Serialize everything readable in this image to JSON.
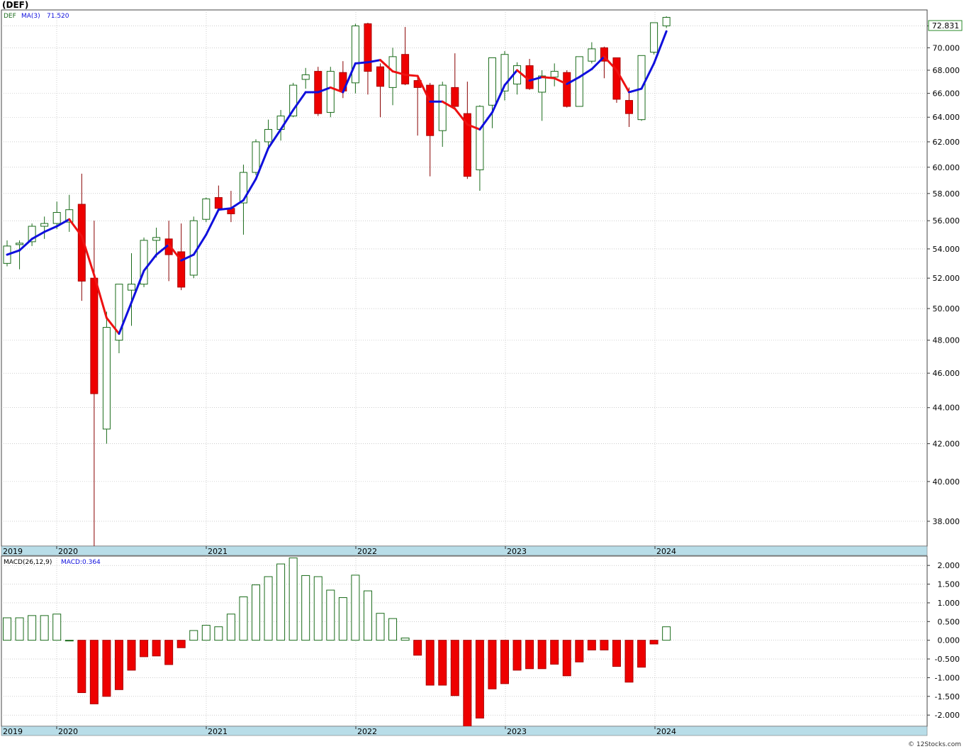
{
  "header": {
    "title": "(DEF)",
    "legend_symbol": "DEF",
    "legend_ma": "MA(3)",
    "legend_ma_value": "71.520",
    "last_price": "72.831",
    "macd_label": "MACD(26,12,9)",
    "macd_value": "MACD:0.364",
    "footer": "© 12Stocks.com"
  },
  "colors": {
    "up_candle": "#1a6b1a",
    "down_candle": "#ee0000",
    "ma_up": "#1010dd",
    "ma_down": "#ee1111",
    "grid": "#b0b0b0",
    "axis_strip": "#b8dde8",
    "price_box": "#2a8a2a"
  },
  "chart_data": [
    {
      "type": "candlestick",
      "title": "(DEF)",
      "x_axis_labels": [
        "2019",
        "2020",
        "2021",
        "2022",
        "2023",
        "2024"
      ],
      "y_ticks": [
        "38.000",
        "40.000",
        "42.000",
        "44.000",
        "46.000",
        "48.000",
        "50.000",
        "52.000",
        "54.000",
        "56.000",
        "58.000",
        "60.000",
        "62.000",
        "64.000",
        "66.000",
        "68.000",
        "70.000",
        "72.000"
      ],
      "ylim": [
        36.8,
        73.5
      ],
      "scale": "log",
      "candles": [
        {
          "date": "2019-08",
          "o": 53.0,
          "h": 54.6,
          "l": 52.8,
          "c": 54.2
        },
        {
          "date": "2019-09",
          "o": 54.3,
          "h": 54.6,
          "l": 52.6,
          "c": 54.4
        },
        {
          "date": "2019-10",
          "o": 54.5,
          "h": 55.8,
          "l": 54.2,
          "c": 55.6
        },
        {
          "date": "2019-11",
          "o": 55.6,
          "h": 56.3,
          "l": 54.7,
          "c": 55.8
        },
        {
          "date": "2019-12",
          "o": 55.8,
          "h": 57.4,
          "l": 55.4,
          "c": 56.6
        },
        {
          "date": "2020-01",
          "o": 55.9,
          "h": 57.9,
          "l": 55.2,
          "c": 56.8
        },
        {
          "date": "2020-02",
          "o": 57.2,
          "h": 59.5,
          "l": 50.5,
          "c": 51.8
        },
        {
          "date": "2020-03",
          "o": 52.0,
          "h": 56.0,
          "l": 36.8,
          "c": 44.8
        },
        {
          "date": "2020-04",
          "o": 42.8,
          "h": 49.8,
          "l": 42.0,
          "c": 48.8
        },
        {
          "date": "2020-05",
          "o": 48.0,
          "h": 51.6,
          "l": 47.2,
          "c": 51.6
        },
        {
          "date": "2020-06",
          "o": 51.2,
          "h": 53.7,
          "l": 48.9,
          "c": 51.6
        },
        {
          "date": "2020-07",
          "o": 51.6,
          "h": 54.8,
          "l": 51.4,
          "c": 54.6
        },
        {
          "date": "2020-08",
          "o": 54.6,
          "h": 55.5,
          "l": 53.4,
          "c": 54.8
        },
        {
          "date": "2020-09",
          "o": 54.7,
          "h": 56.0,
          "l": 51.8,
          "c": 53.6
        },
        {
          "date": "2020-10",
          "o": 53.8,
          "h": 55.8,
          "l": 51.2,
          "c": 51.4
        },
        {
          "date": "2020-11",
          "o": 52.2,
          "h": 56.3,
          "l": 52.0,
          "c": 56.0
        },
        {
          "date": "2020-12",
          "o": 56.1,
          "h": 57.7,
          "l": 55.9,
          "c": 57.6
        },
        {
          "date": "2021-01",
          "o": 57.7,
          "h": 58.6,
          "l": 56.7,
          "c": 56.9
        },
        {
          "date": "2021-02",
          "o": 56.9,
          "h": 58.2,
          "l": 55.9,
          "c": 56.5
        },
        {
          "date": "2021-03",
          "o": 57.3,
          "h": 60.2,
          "l": 55.0,
          "c": 59.6
        },
        {
          "date": "2021-04",
          "o": 59.6,
          "h": 62.2,
          "l": 59.4,
          "c": 62.0
        },
        {
          "date": "2021-05",
          "o": 62.0,
          "h": 63.8,
          "l": 61.6,
          "c": 63.0
        },
        {
          "date": "2021-06",
          "o": 63.0,
          "h": 64.6,
          "l": 62.1,
          "c": 64.1
        },
        {
          "date": "2021-07",
          "o": 64.1,
          "h": 66.9,
          "l": 64.0,
          "c": 66.7
        },
        {
          "date": "2021-08",
          "o": 67.2,
          "h": 68.2,
          "l": 66.4,
          "c": 67.6
        },
        {
          "date": "2021-09",
          "o": 67.9,
          "h": 68.3,
          "l": 64.1,
          "c": 64.3
        },
        {
          "date": "2021-10",
          "o": 64.4,
          "h": 68.3,
          "l": 64.0,
          "c": 67.9
        },
        {
          "date": "2021-11",
          "o": 67.8,
          "h": 68.8,
          "l": 65.6,
          "c": 66.2
        },
        {
          "date": "2021-12",
          "o": 66.9,
          "h": 72.2,
          "l": 66.0,
          "c": 72.0
        },
        {
          "date": "2022-01",
          "o": 72.2,
          "h": 72.3,
          "l": 65.9,
          "c": 67.9
        },
        {
          "date": "2022-02",
          "o": 68.3,
          "h": 68.6,
          "l": 64.0,
          "c": 66.6
        },
        {
          "date": "2022-03",
          "o": 66.5,
          "h": 70.0,
          "l": 65.0,
          "c": 69.2
        },
        {
          "date": "2022-04",
          "o": 69.4,
          "h": 71.9,
          "l": 66.7,
          "c": 66.8
        },
        {
          "date": "2022-05",
          "o": 67.1,
          "h": 67.4,
          "l": 62.5,
          "c": 66.5
        },
        {
          "date": "2022-06",
          "o": 66.7,
          "h": 66.9,
          "l": 59.3,
          "c": 62.5
        },
        {
          "date": "2022-07",
          "o": 62.9,
          "h": 67.0,
          "l": 61.6,
          "c": 66.7
        },
        {
          "date": "2022-08",
          "o": 66.5,
          "h": 69.5,
          "l": 64.8,
          "c": 64.9
        },
        {
          "date": "2022-09",
          "o": 64.3,
          "h": 67.0,
          "l": 59.1,
          "c": 59.3
        },
        {
          "date": "2022-10",
          "o": 59.8,
          "h": 65.0,
          "l": 58.2,
          "c": 64.9
        },
        {
          "date": "2022-11",
          "o": 65.0,
          "h": 69.1,
          "l": 63.1,
          "c": 69.1
        },
        {
          "date": "2022-12",
          "o": 66.2,
          "h": 69.7,
          "l": 65.4,
          "c": 69.4
        },
        {
          "date": "2023-01",
          "o": 66.8,
          "h": 68.7,
          "l": 65.9,
          "c": 68.4
        },
        {
          "date": "2023-02",
          "o": 68.4,
          "h": 69.0,
          "l": 66.3,
          "c": 66.4
        },
        {
          "date": "2023-03",
          "o": 66.1,
          "h": 68.0,
          "l": 63.7,
          "c": 67.5
        },
        {
          "date": "2023-04",
          "o": 67.4,
          "h": 68.6,
          "l": 66.6,
          "c": 67.9
        },
        {
          "date": "2023-05",
          "o": 67.8,
          "h": 68.0,
          "l": 64.8,
          "c": 64.9
        },
        {
          "date": "2023-06",
          "o": 64.9,
          "h": 69.2,
          "l": 64.9,
          "c": 69.2
        },
        {
          "date": "2023-07",
          "o": 68.8,
          "h": 70.5,
          "l": 68.6,
          "c": 69.9
        },
        {
          "date": "2023-08",
          "o": 70.0,
          "h": 70.1,
          "l": 67.3,
          "c": 68.8
        },
        {
          "date": "2023-09",
          "o": 69.1,
          "h": 69.1,
          "l": 65.2,
          "c": 65.5
        },
        {
          "date": "2023-10",
          "o": 65.4,
          "h": 66.5,
          "l": 63.2,
          "c": 64.3
        },
        {
          "date": "2023-11",
          "o": 63.8,
          "h": 69.3,
          "l": 63.7,
          "c": 69.3
        },
        {
          "date": "2023-12",
          "o": 69.6,
          "h": 72.3,
          "l": 69.4,
          "c": 72.3
        },
        {
          "date": "2024-01",
          "o": 72.0,
          "h": 72.9,
          "l": 71.8,
          "c": 72.8
        }
      ],
      "ma3": [
        53.6,
        53.9,
        54.7,
        55.2,
        55.6,
        56.1,
        54.9,
        52.2,
        49.4,
        48.4,
        50.4,
        52.5,
        53.6,
        54.3,
        53.2,
        53.6,
        55.0,
        56.8,
        56.9,
        57.5,
        59.1,
        61.5,
        63.0,
        64.6,
        66.1,
        66.1,
        66.5,
        66.1,
        68.6,
        68.7,
        68.9,
        67.9,
        67.6,
        67.5,
        65.3,
        65.3,
        64.7,
        63.4,
        63.0,
        64.4,
        66.7,
        68.0,
        67.1,
        67.4,
        67.3,
        66.8,
        67.4,
        68.1,
        69.2,
        68.0,
        66.1,
        66.4,
        68.6,
        71.5
      ]
    },
    {
      "type": "bar",
      "title": "MACD(26,12,9)",
      "y_ticks": [
        "2.000",
        "1.500",
        "1.000",
        "0.500",
        "0.000",
        "-0.500",
        "-1.000",
        "-1.500",
        "-2.000"
      ],
      "ylim": [
        -2.3,
        2.25
      ],
      "values": [
        0.6,
        0.6,
        0.66,
        0.66,
        0.7,
        0.0,
        -1.4,
        -1.7,
        -1.5,
        -1.32,
        -0.8,
        -0.44,
        -0.42,
        -0.65,
        -0.2,
        0.26,
        0.4,
        0.36,
        0.7,
        1.16,
        1.48,
        1.7,
        2.04,
        2.2,
        1.73,
        1.7,
        1.34,
        1.14,
        1.74,
        1.32,
        0.72,
        0.58,
        0.06,
        -0.4,
        -1.2,
        -1.2,
        -1.48,
        -2.35,
        -2.08,
        -1.3,
        -1.16,
        -0.8,
        -0.76,
        -0.76,
        -0.64,
        -0.95,
        -0.58,
        -0.26,
        -0.26,
        -0.7,
        -1.12,
        -0.72,
        -0.1,
        0.36
      ]
    }
  ]
}
